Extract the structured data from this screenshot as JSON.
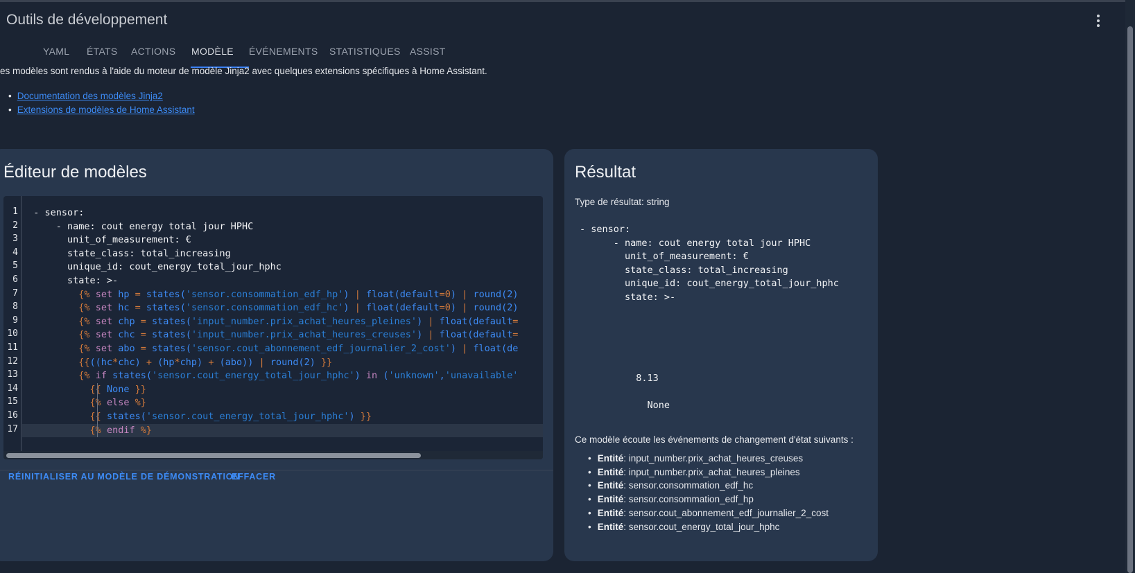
{
  "header": {
    "title": "Outils de développement"
  },
  "tabs": [
    {
      "label": "YAML"
    },
    {
      "label": "ÉTATS"
    },
    {
      "label": "ACTIONS"
    },
    {
      "label": "MODÈLE"
    },
    {
      "label": "ÉVÉNEMENTS"
    },
    {
      "label": "STATISTIQUES"
    },
    {
      "label": "ASSIST"
    }
  ],
  "intro": {
    "text": "es modèles sont rendus à l'aide du moteur de modèle Jinja2 avec quelques extensions spécifiques à Home Assistant."
  },
  "links": [
    {
      "label": "Documentation des modèles Jinja2"
    },
    {
      "label": "Extensions de modèles de Home Assistant"
    }
  ],
  "editor": {
    "title": "Éditeur de modèles",
    "line_numbers": [
      "1",
      "2",
      "3",
      "4",
      "5",
      "6",
      "7",
      "8",
      "9",
      "10",
      "11",
      "12",
      "13",
      "14",
      "15",
      "16",
      "17"
    ],
    "reset_label": "RÉINITIALISER AU MODÈLE DE DÉMONSTRATION",
    "clear_label": "EFFACER"
  },
  "result": {
    "title": "Résultat",
    "type_text": "Type de résultat: string",
    "output_lines": [
      "- sensor:",
      "      - name: cout energy total jour HPHC",
      "        unit_of_measurement: €",
      "        state_class: total_increasing",
      "        unique_id: cout_energy_total_jour_hphc",
      "        state: >-",
      "",
      "",
      "",
      "",
      "",
      "          8.13",
      "",
      "            None"
    ],
    "listens_text": "Ce modèle écoute les événements de changement d'état suivants :",
    "entity_label": "Entité",
    "entities": [
      ": input_number.prix_achat_heures_creuses",
      ": input_number.prix_achat_heures_pleines",
      ": sensor.consommation_edf_hc",
      ": sensor.consommation_edf_hp",
      ": sensor.cout_abonnement_edf_journalier_2_cost",
      ": sensor.cout_energy_total_jour_hphc"
    ]
  },
  "colors": {
    "background": "#1b2433",
    "card": "#28374d",
    "accent": "#3d8bf5",
    "jinja_delim": "#d1793b",
    "string": "#2b7fd6"
  },
  "icons": {
    "menu": "more-vert-icon"
  }
}
